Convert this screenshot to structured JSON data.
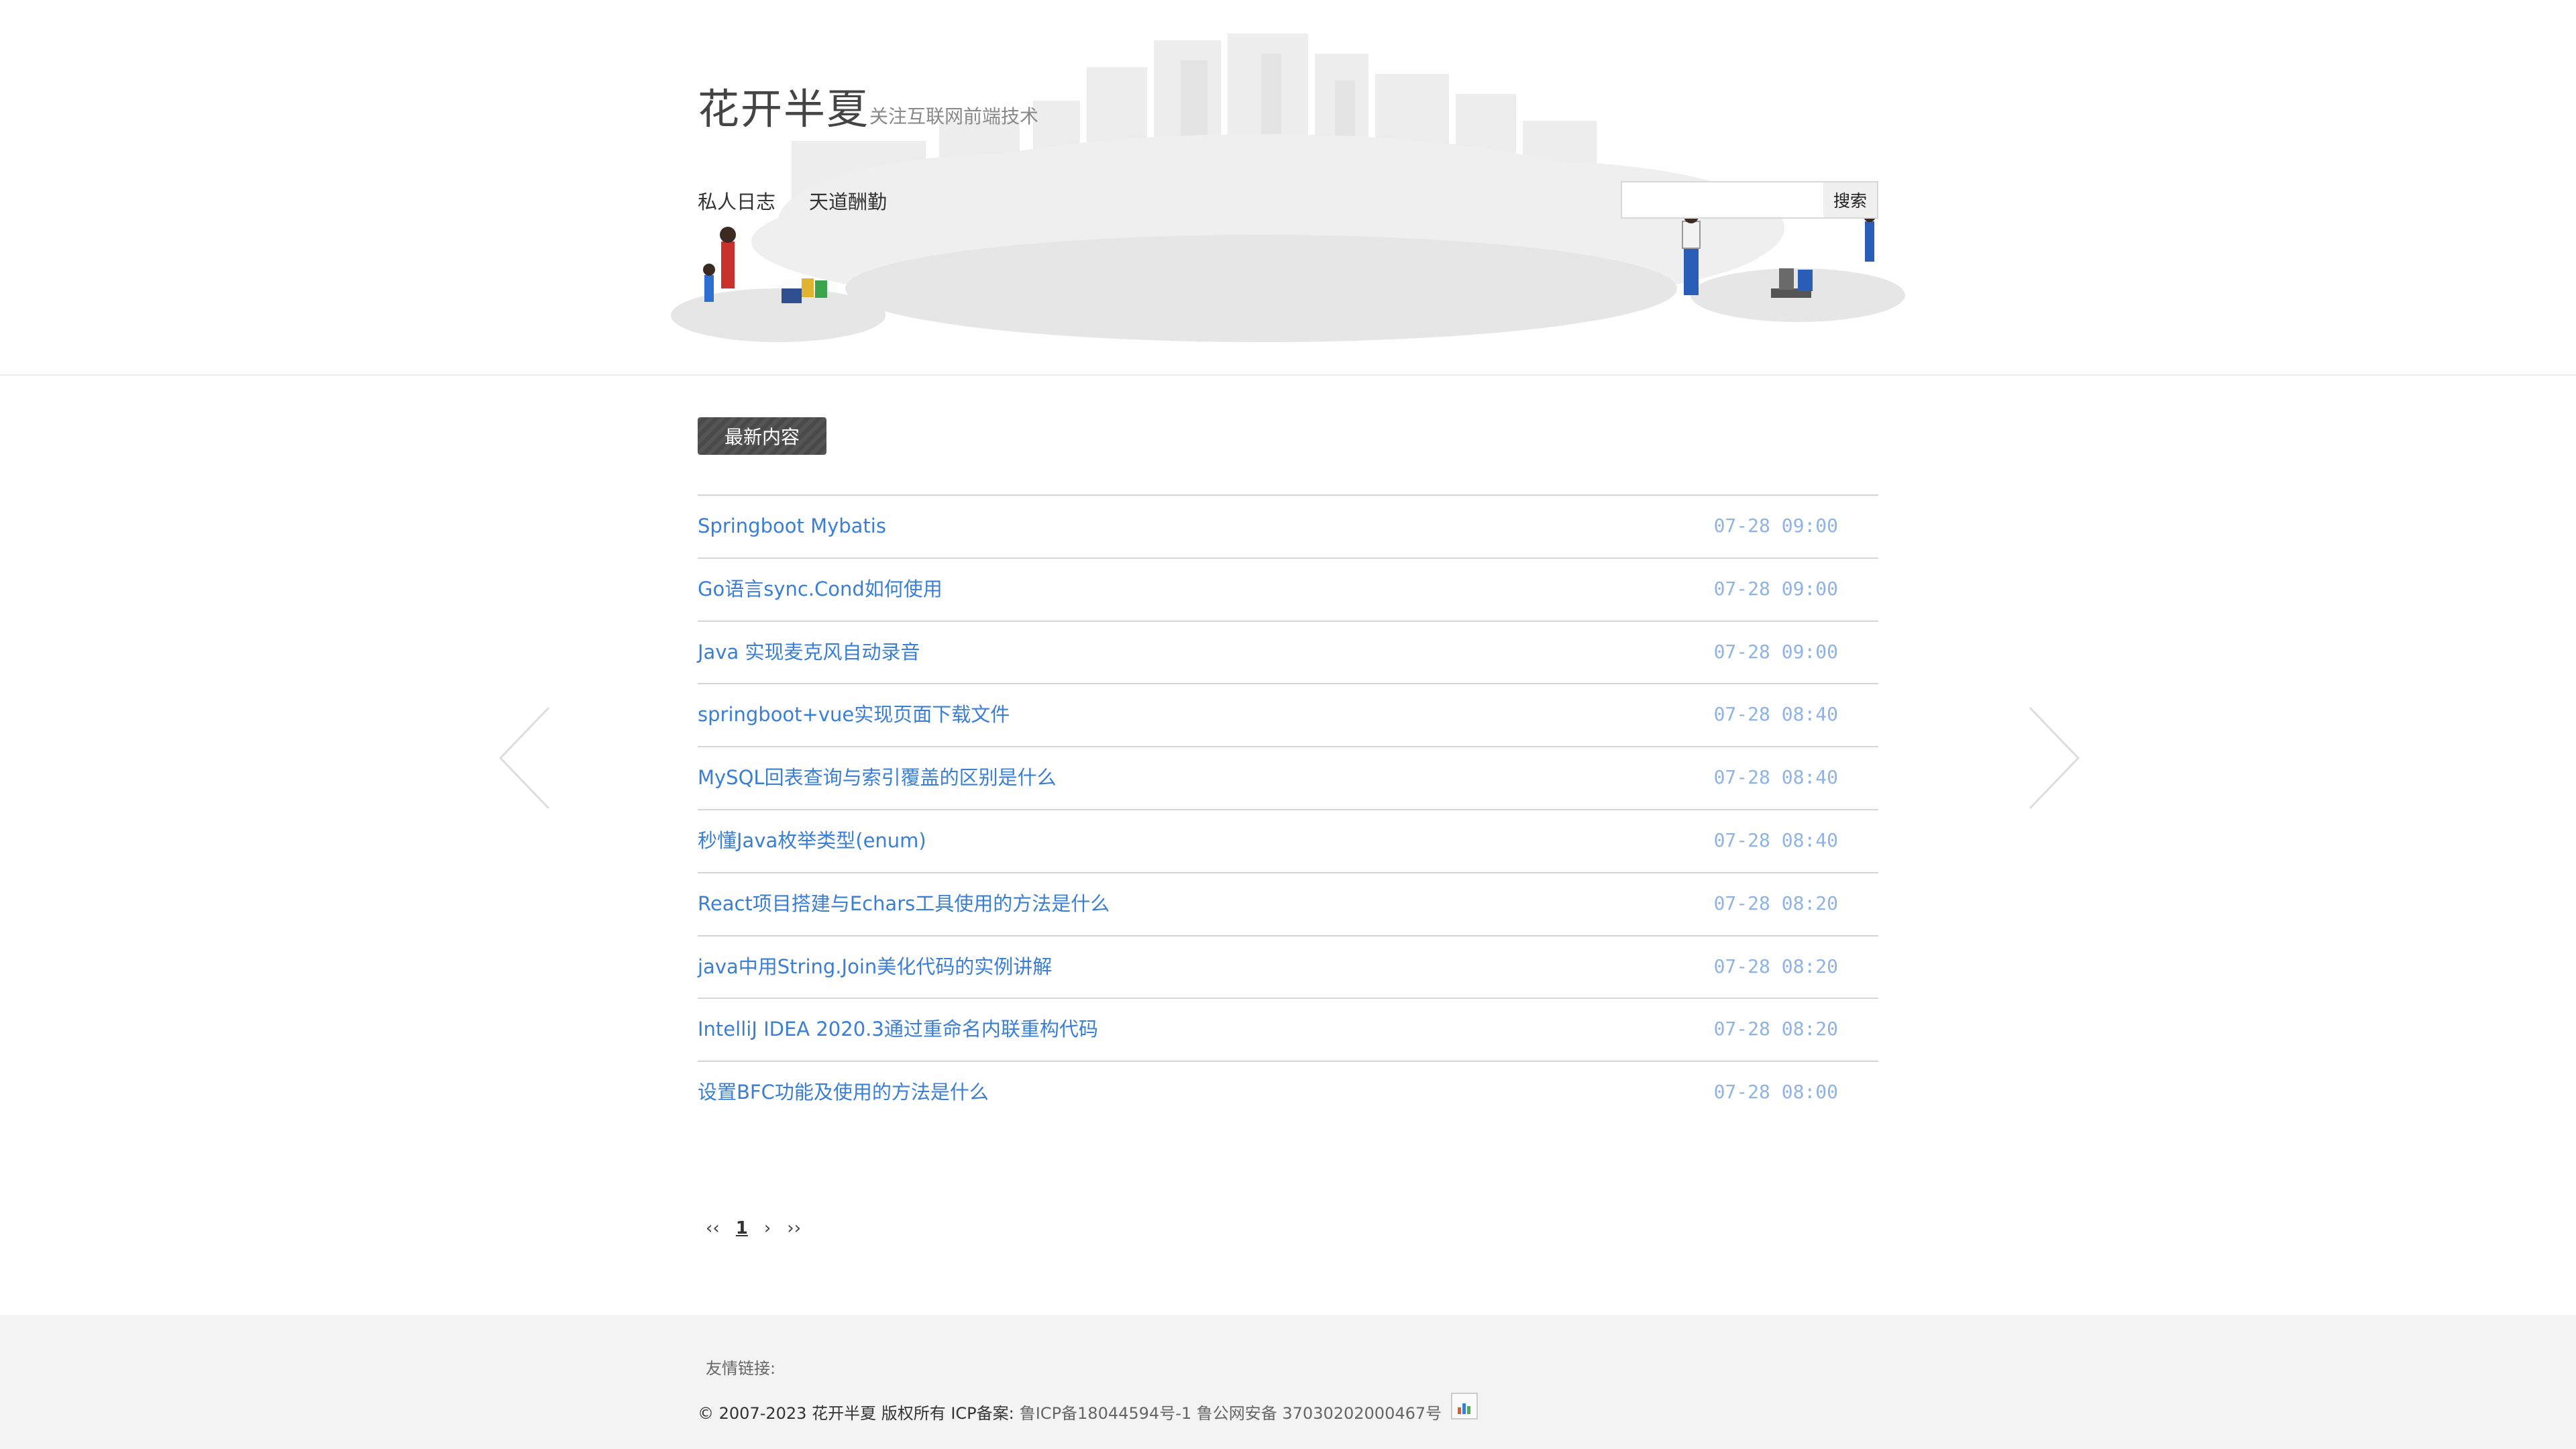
{
  "site": {
    "title": "花开半夏",
    "subtitle": "关注互联网前端技术"
  },
  "nav": {
    "items": [
      "私人日志",
      "天道酬勤"
    ]
  },
  "search": {
    "value": "",
    "button_label": "搜索"
  },
  "section": {
    "label": "最新内容"
  },
  "posts": [
    {
      "title": "Springboot Mybatis",
      "time": "07-28 09:00"
    },
    {
      "title": "Go语言sync.Cond如何使用",
      "time": "07-28 09:00"
    },
    {
      "title": "Java 实现麦克风自动录音",
      "time": "07-28 09:00"
    },
    {
      "title": "springboot+vue实现页面下载文件",
      "time": "07-28 08:40"
    },
    {
      "title": "MySQL回表查询与索引覆盖的区别是什么",
      "time": "07-28 08:40"
    },
    {
      "title": "秒懂Java枚举类型(enum)",
      "time": "07-28 08:40"
    },
    {
      "title": "React项目搭建与Echars工具使用的方法是什么",
      "time": "07-28 08:20"
    },
    {
      "title": "java中用String.Join美化代码的实例讲解",
      "time": "07-28 08:20"
    },
    {
      "title": "IntelliJ IDEA 2020.3通过重命名内联重构代码",
      "time": "07-28 08:20"
    },
    {
      "title": "设置BFC功能及使用的方法是什么",
      "time": "07-28 08:00"
    }
  ],
  "pager": {
    "first": "‹‹",
    "current": "1",
    "next": "›",
    "last": "››"
  },
  "footer": {
    "friend_links_label": "友情链接:",
    "copyright": "© 2007-2023 花开半夏 版权所有 ICP备案:",
    "icp": "鲁ICP备18044594号-1 鲁公网安备 37030202000467号"
  },
  "colors": {
    "link": "#3a7fd5",
    "time": "#8fb3e4",
    "badge": "#555555",
    "footer_bg": "#f3f3f3"
  }
}
